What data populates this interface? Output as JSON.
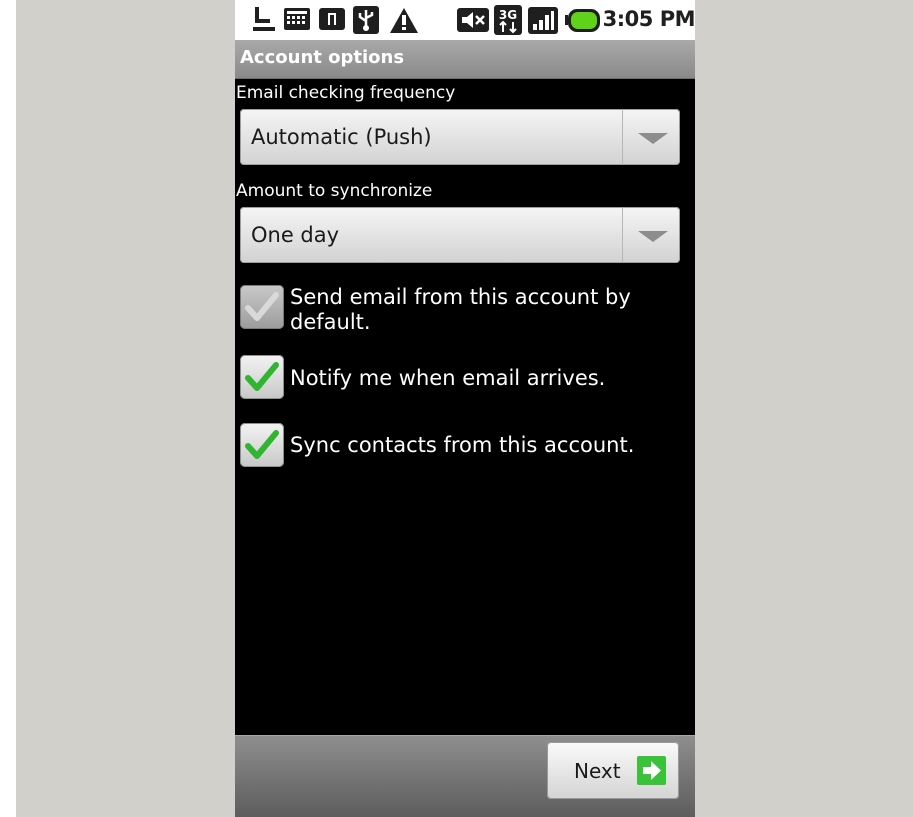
{
  "status_bar": {
    "time": "3:05 PM",
    "icons": [
      "download-icon",
      "keyboard-icon",
      "sim-icon",
      "usb-icon",
      "warning-icon",
      "mute-icon",
      "3g-icon",
      "signal-icon",
      "battery-icon"
    ],
    "network_badge": "3G"
  },
  "title_bar": {
    "title": "Account options"
  },
  "form": {
    "frequency": {
      "label": "Email checking frequency",
      "value": "Automatic (Push)"
    },
    "sync_amount": {
      "label": "Amount to synchronize",
      "value": "One day"
    },
    "checkboxes": [
      {
        "label": "Send email from this account by default.",
        "checked": true,
        "enabled": false
      },
      {
        "label": "Notify me when email arrives.",
        "checked": true,
        "enabled": true
      },
      {
        "label": "Sync contacts from this account.",
        "checked": true,
        "enabled": true
      }
    ]
  },
  "footer": {
    "next_label": "Next"
  },
  "colors": {
    "backdrop": "#d1d0ca",
    "screen": "#000000",
    "check_green": "#2fb52f",
    "next_arrow_green": "#39c23a"
  }
}
